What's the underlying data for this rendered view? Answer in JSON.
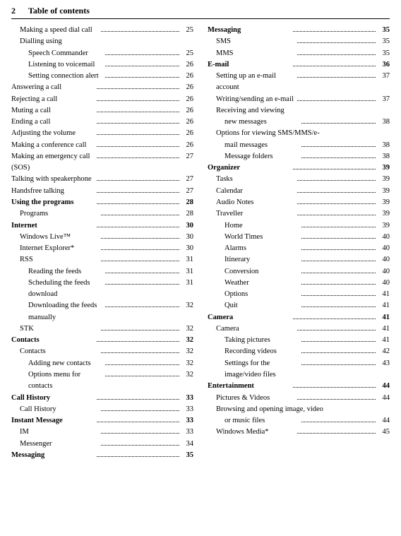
{
  "header": {
    "num": "2",
    "title": "Table of contents"
  },
  "left_col": [
    {
      "label": "Making a speed dial call",
      "page": "25",
      "indent": 1,
      "bold": false
    },
    {
      "label": "Dialling using",
      "page": "",
      "indent": 1,
      "bold": false
    },
    {
      "label": "Speech Commander",
      "page": "25",
      "indent": 2,
      "bold": false
    },
    {
      "label": "Listening to voicemail",
      "page": "26",
      "indent": 2,
      "bold": false
    },
    {
      "label": "Setting connection alert",
      "page": "26",
      "indent": 2,
      "bold": false
    },
    {
      "label": "Answering a call",
      "page": "26",
      "indent": 0,
      "bold": false
    },
    {
      "label": "Rejecting a call",
      "page": "26",
      "indent": 0,
      "bold": false
    },
    {
      "label": "Muting a call",
      "page": "26",
      "indent": 0,
      "bold": false
    },
    {
      "label": "Ending a call",
      "page": "26",
      "indent": 0,
      "bold": false
    },
    {
      "label": "Adjusting the volume",
      "page": "26",
      "indent": 0,
      "bold": false
    },
    {
      "label": "Making a conference call",
      "page": "26",
      "indent": 0,
      "bold": false
    },
    {
      "label": "Making an emergency call (SOS)",
      "page": "27",
      "indent": 0,
      "bold": false
    },
    {
      "label": "Talking with speakerphone",
      "page": "27",
      "indent": 0,
      "bold": false
    },
    {
      "label": "Handsfree talking",
      "page": "27",
      "indent": 0,
      "bold": false
    },
    {
      "label": "Using the programs",
      "page": "28",
      "indent": 0,
      "bold": true
    },
    {
      "label": "Programs",
      "page": "28",
      "indent": 1,
      "bold": false
    },
    {
      "label": "Internet",
      "page": "30",
      "indent": 0,
      "bold": true
    },
    {
      "label": "Windows Live™",
      "page": "30",
      "indent": 1,
      "bold": false
    },
    {
      "label": "Internet Explorer*",
      "page": "30",
      "indent": 1,
      "bold": false
    },
    {
      "label": "RSS",
      "page": "31",
      "indent": 1,
      "bold": false
    },
    {
      "label": "Reading the feeds",
      "page": "31",
      "indent": 2,
      "bold": false
    },
    {
      "label": "Scheduling the feeds download",
      "page": "31",
      "indent": 2,
      "bold": false
    },
    {
      "label": "Downloading the feeds manually",
      "page": "32",
      "indent": 2,
      "bold": false
    },
    {
      "label": "STK",
      "page": "32",
      "indent": 1,
      "bold": false
    },
    {
      "label": "Contacts",
      "page": "32",
      "indent": 0,
      "bold": true
    },
    {
      "label": "Contacts",
      "page": "32",
      "indent": 1,
      "bold": false
    },
    {
      "label": "Adding new contacts",
      "page": "32",
      "indent": 2,
      "bold": false
    },
    {
      "label": "Options menu for contacts",
      "page": "32",
      "indent": 2,
      "bold": false
    },
    {
      "label": "Call History",
      "page": "33",
      "indent": 0,
      "bold": true
    },
    {
      "label": "Call History",
      "page": "33",
      "indent": 1,
      "bold": false
    },
    {
      "label": "Instant Message",
      "page": "33",
      "indent": 0,
      "bold": true
    },
    {
      "label": "IM",
      "page": "33",
      "indent": 1,
      "bold": false
    },
    {
      "label": "Messenger",
      "page": "34",
      "indent": 1,
      "bold": false
    },
    {
      "label": "Messaging",
      "page": "35",
      "indent": 0,
      "bold": true
    }
  ],
  "right_col": [
    {
      "label": "Messaging",
      "page": "35",
      "indent": 0,
      "bold": true
    },
    {
      "label": "SMS",
      "page": "35",
      "indent": 1,
      "bold": false
    },
    {
      "label": "MMS",
      "page": "35",
      "indent": 1,
      "bold": false
    },
    {
      "label": "E-mail",
      "page": "36",
      "indent": 0,
      "bold": true
    },
    {
      "label": "Setting up an e-mail account",
      "page": "37",
      "indent": 1,
      "bold": false
    },
    {
      "label": "Writing/sending an e-mail",
      "page": "37",
      "indent": 1,
      "bold": false
    },
    {
      "label": "Receiving and viewing",
      "page": "",
      "indent": 1,
      "bold": false
    },
    {
      "label": "new messages",
      "page": "38",
      "indent": 2,
      "bold": false
    },
    {
      "label": "Options for viewing SMS/MMS/e-",
      "page": "",
      "indent": 1,
      "bold": false
    },
    {
      "label": "mail messages",
      "page": "38",
      "indent": 2,
      "bold": false
    },
    {
      "label": "Message folders",
      "page": "38",
      "indent": 2,
      "bold": false
    },
    {
      "label": "Organizer",
      "page": "39",
      "indent": 0,
      "bold": true
    },
    {
      "label": "Tasks",
      "page": "39",
      "indent": 1,
      "bold": false
    },
    {
      "label": "Calendar",
      "page": "39",
      "indent": 1,
      "bold": false
    },
    {
      "label": "Audio Notes",
      "page": "39",
      "indent": 1,
      "bold": false
    },
    {
      "label": "Traveller",
      "page": "39",
      "indent": 1,
      "bold": false
    },
    {
      "label": "Home",
      "page": "39",
      "indent": 2,
      "bold": false
    },
    {
      "label": "World Times",
      "page": "40",
      "indent": 2,
      "bold": false
    },
    {
      "label": "Alarms",
      "page": "40",
      "indent": 2,
      "bold": false
    },
    {
      "label": "Itinerary",
      "page": "40",
      "indent": 2,
      "bold": false
    },
    {
      "label": "Conversion",
      "page": "40",
      "indent": 2,
      "bold": false
    },
    {
      "label": "Weather",
      "page": "40",
      "indent": 2,
      "bold": false
    },
    {
      "label": "Options",
      "page": "41",
      "indent": 2,
      "bold": false
    },
    {
      "label": "Quit",
      "page": "41",
      "indent": 2,
      "bold": false
    },
    {
      "label": "Camera",
      "page": "41",
      "indent": 0,
      "bold": true
    },
    {
      "label": "Camera",
      "page": "41",
      "indent": 1,
      "bold": false
    },
    {
      "label": "Taking pictures",
      "page": "41",
      "indent": 2,
      "bold": false
    },
    {
      "label": "Recording videos",
      "page": "42",
      "indent": 2,
      "bold": false
    },
    {
      "label": "Settings for the image/video files",
      "page": "43",
      "indent": 2,
      "bold": false
    },
    {
      "label": "Entertainment",
      "page": "44",
      "indent": 0,
      "bold": true
    },
    {
      "label": "Pictures & Videos",
      "page": "44",
      "indent": 1,
      "bold": false
    },
    {
      "label": "Browsing and opening image, video",
      "page": "",
      "indent": 1,
      "bold": false
    },
    {
      "label": "or music files",
      "page": "44",
      "indent": 2,
      "bold": false
    },
    {
      "label": "Windows Media*",
      "page": "45",
      "indent": 1,
      "bold": false
    }
  ]
}
